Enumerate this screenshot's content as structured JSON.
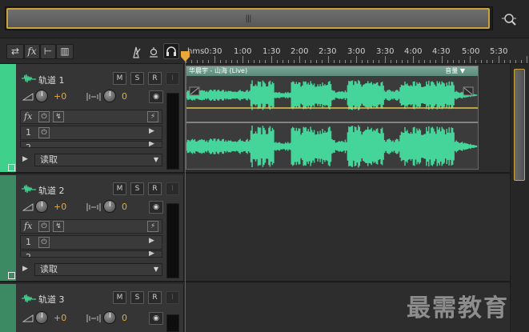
{
  "overview": {
    "grip": "|||"
  },
  "toolbar": {
    "loop_label": "⇄",
    "fx_label": "fx",
    "sends_label": "⊢",
    "eq_label": "▥"
  },
  "ruler": {
    "unit": "hms",
    "ticks": [
      "0:30",
      "1:00",
      "1:30",
      "2:00",
      "2:30",
      "3:00",
      "3:30",
      "4:00",
      "4:30",
      "5:00",
      "5:30"
    ]
  },
  "tracks": [
    {
      "name": "轨道 1",
      "mute": "M",
      "solo": "S",
      "record": "R",
      "input": "I",
      "volume": "+0",
      "pan": "0",
      "fx_label": "fx",
      "slot1": "1",
      "slot2": "2",
      "automation": "读取"
    },
    {
      "name": "轨道 2",
      "mute": "M",
      "solo": "S",
      "record": "R",
      "input": "I",
      "volume": "+0",
      "pan": "0",
      "fx_label": "fx",
      "slot1": "1",
      "slot2": "2",
      "automation": "读取"
    },
    {
      "name": "轨道 3",
      "mute": "M",
      "solo": "S",
      "record": "R",
      "input": "I",
      "volume": "+0",
      "pan": "0"
    }
  ],
  "clip": {
    "name": "华晨宇 - 山海 (Live)",
    "volume_label": "音量 ▼"
  },
  "colors": {
    "accent": "#c9a23a",
    "waveform": "#45d49a",
    "track_strip": "#3fd18c",
    "volume_value": "#e8a93a"
  },
  "watermark": "最需教育"
}
